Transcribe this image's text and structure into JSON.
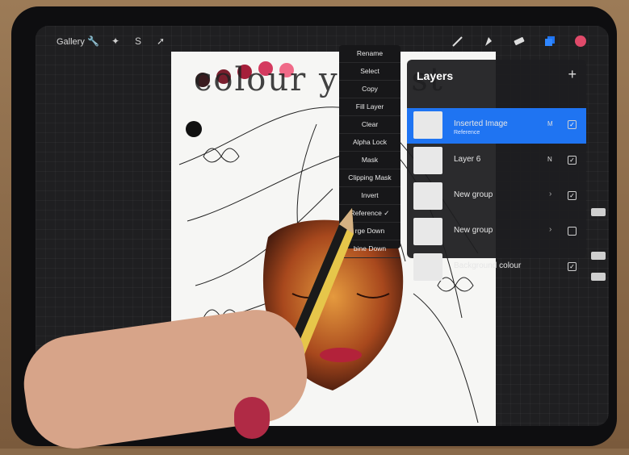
{
  "topbar": {
    "gallery_label": "Gallery",
    "left_tools": [
      "wrench-icon",
      "magic-wand-icon",
      "selection-icon",
      "transform-icon"
    ],
    "right_tools": [
      "brush-icon",
      "smudge-icon",
      "eraser-icon",
      "layers-icon",
      "color-swatch"
    ],
    "active_color": "#e04a6a"
  },
  "context_menu": {
    "items": [
      "Rename",
      "Select",
      "Copy",
      "Fill Layer",
      "Clear",
      "Alpha Lock",
      "Mask",
      "Clipping Mask",
      "Invert",
      "Reference ✓",
      "rge Down",
      "bine Down"
    ]
  },
  "layers_panel": {
    "title": "Layers",
    "add_symbol": "+",
    "layers": [
      {
        "name": "Inserted Image",
        "subtitle": "Reference",
        "blend": "M",
        "visible": true,
        "active": true
      },
      {
        "name": "Layer 6",
        "subtitle": "",
        "blend": "N",
        "visible": true,
        "active": false
      },
      {
        "name": "New group",
        "subtitle": "",
        "blend": "",
        "visible": true,
        "active": false,
        "group": true
      },
      {
        "name": "New group",
        "subtitle": "",
        "blend": "",
        "visible": false,
        "active": false,
        "group": true
      },
      {
        "name": "Background colour",
        "subtitle": "",
        "blend": "",
        "visible": true,
        "active": false
      }
    ]
  },
  "artwork": {
    "headline": "colour your st",
    "palette": [
      "#3a1c1f",
      "#7a1f2e",
      "#a51f3a",
      "#d43a5f",
      "#f06a88"
    ]
  }
}
